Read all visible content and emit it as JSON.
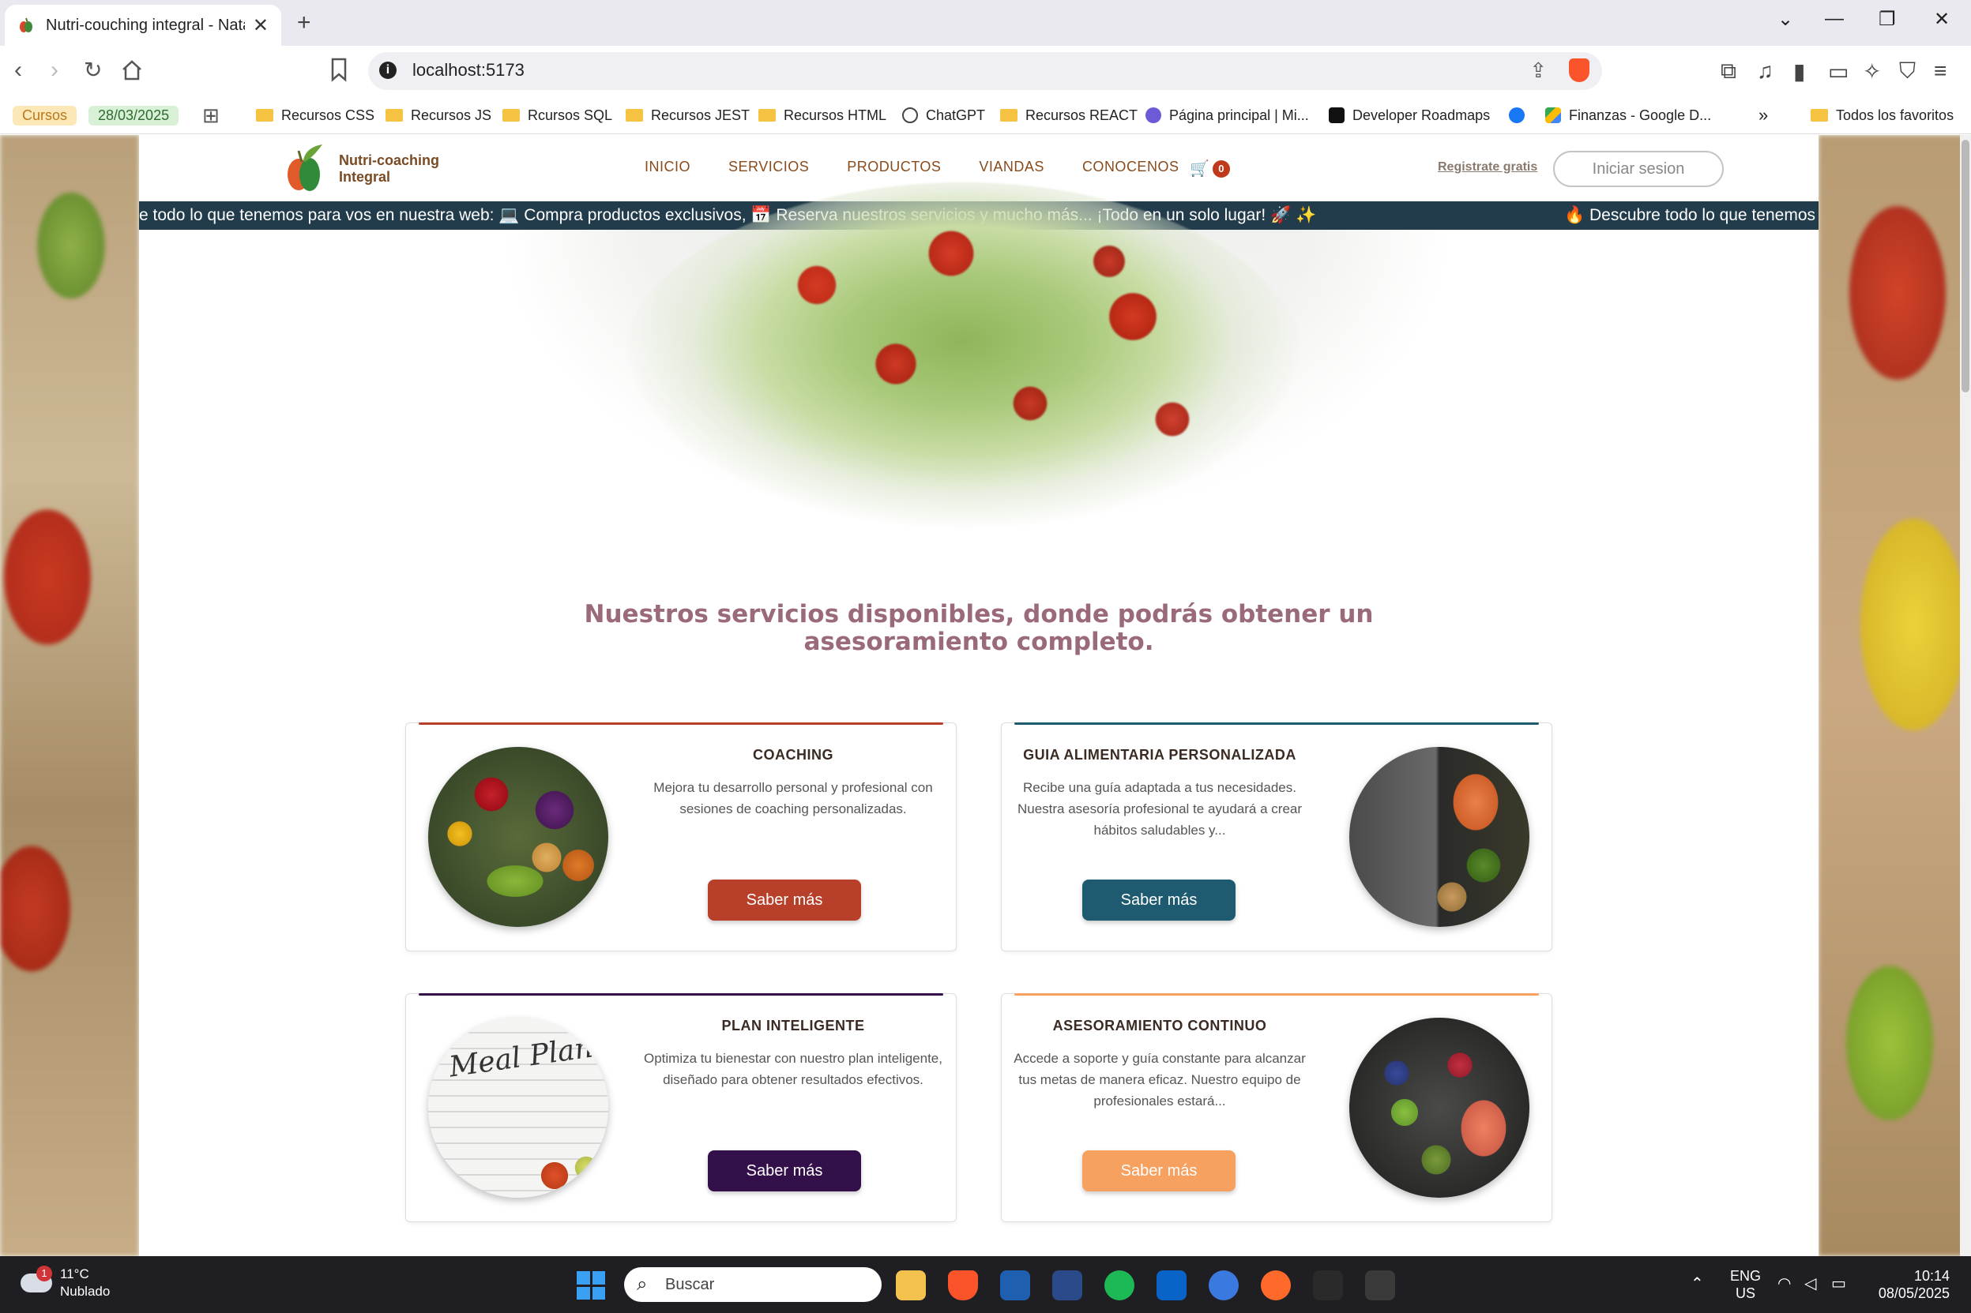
{
  "browser": {
    "tab_title": "Nutri-couching integral - Natas",
    "new_tab": "+",
    "url": "localhost:5173",
    "window_controls": [
      "⌄",
      "—",
      "❐",
      "✕"
    ]
  },
  "bookmarks": {
    "chip_cursos": "Cursos",
    "chip_date": "28/03/2025",
    "items": [
      "Recursos CSS",
      "Recursos JS",
      "Rcursos SQL",
      "Recursos JEST",
      "Recursos HTML",
      "ChatGPT",
      "Recursos REACT",
      "Página principal | Mi...",
      "Developer Roadmaps",
      "Finanzas - Google D..."
    ],
    "more": "»",
    "all_favorites": "Todos los favoritos"
  },
  "site": {
    "brand_line1": "Nutri-coaching",
    "brand_line2": "Integral",
    "nav": [
      "INICIO",
      "SERVICIOS",
      "PRODUCTOS",
      "VIANDAS",
      "CONOCENOS"
    ],
    "cart_count": "0",
    "register": "Registrate gratis",
    "login": "Iniciar sesion",
    "marquee_1": "e todo lo que tenemos para vos en nuestra web: 💻 Compra productos exclusivos, 📅 Reserva nuestros servicios y mucho más... ¡Todo en un solo lugar! 🚀 ✨",
    "marquee_2": "🔥 Descubre todo lo que tenemos",
    "headline": "Nuestros servicios disponibles, donde podrás obtener un asesoramiento completo.",
    "cards": [
      {
        "title": "COACHING",
        "desc": "Mejora tu desarrollo personal y profesional con sesiones de coaching personalizadas.",
        "button": "Saber más",
        "accent": "#b8402b"
      },
      {
        "title": "GUIA ALIMENTARIA PERSONALIZADA",
        "desc": "Recibe una guía adaptada a tus necesidades. Nuestra asesoría profesional te ayudará a crear hábitos saludables y...",
        "button": "Saber más",
        "accent": "#1e5a70"
      },
      {
        "title": "PLAN INTELIGENTE",
        "desc": "Optimiza tu bienestar con nuestro plan inteligente, diseñado para obtener resultados efectivos.",
        "button": "Saber más",
        "accent": "#34104a"
      },
      {
        "title": "ASESORAMIENTO CONTINUO",
        "desc": "Accede a soporte y guía constante para alcanzar tus metas de manera eficaz. Nuestro equipo de profesionales estará...",
        "button": "Saber más",
        "accent": "#f7a160"
      }
    ],
    "meal_plan_text": "Meal Plan"
  },
  "taskbar": {
    "weather_badge": "1",
    "temperature": "11°C",
    "condition": "Nublado",
    "search_placeholder": "Buscar",
    "lang_1": "ENG",
    "lang_2": "US",
    "time": "10:14",
    "date": "08/05/2025"
  }
}
